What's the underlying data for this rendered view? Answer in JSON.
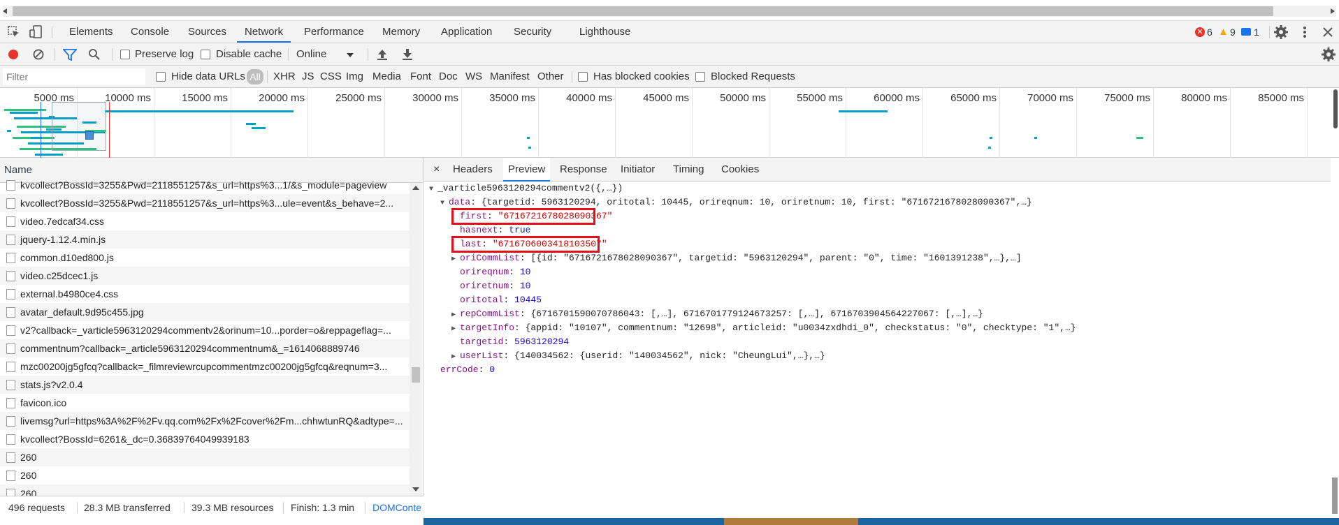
{
  "devtools": {
    "tabs": [
      "Elements",
      "Console",
      "Sources",
      "Network",
      "Performance",
      "Memory",
      "Application",
      "Security",
      "Lighthouse"
    ],
    "active_tab": "Network",
    "errors": "6",
    "warnings": "9",
    "info": "1"
  },
  "toolbar": {
    "preserve_log": "Preserve log",
    "disable_cache": "Disable cache",
    "throttling": "Online"
  },
  "filterbar": {
    "filter_placeholder": "Filter",
    "hide_data_urls": "Hide data URLs",
    "types": [
      "All",
      "XHR",
      "JS",
      "CSS",
      "Img",
      "Media",
      "Font",
      "Doc",
      "WS",
      "Manifest",
      "Other"
    ],
    "active_type": "All",
    "has_blocked_cookies": "Has blocked cookies",
    "blocked_requests": "Blocked Requests"
  },
  "timeline": {
    "ticks": [
      "5000 ms",
      "10000 ms",
      "15000 ms",
      "20000 ms",
      "25000 ms",
      "30000 ms",
      "35000 ms",
      "40000 ms",
      "45000 ms",
      "50000 ms",
      "55000 ms",
      "60000 ms",
      "65000 ms",
      "70000 ms",
      "75000 ms",
      "80000 ms",
      "85000 ms"
    ]
  },
  "requests": {
    "header": "Name",
    "items": [
      "kvcollect?BossId=3255&Pwd=2118551257&s_url=https%3...1/&s_module=pageview",
      "kvcollect?BossId=3255&Pwd=2118551257&s_url=https%3...ule=event&s_behave=2...",
      "video.7edcaf34.css",
      "jquery-1.12.4.min.js",
      "common.d10ed800.js",
      "video.c25dcec1.js",
      "external.b4980ce4.css",
      "avatar_default.9d95c455.jpg",
      "v2?callback=_varticle5963120294commentv2&orinum=10...porder=o&reppageflag=...",
      "commentnum?callback=_article5963120294commentnum&_=1614068889746",
      "mzc00200jg5gfcq?callback=_filmreviewrcupcommentmzc00200jg5gfcq&reqnum=3...",
      "stats.js?v2.0.4",
      "favicon.ico",
      "livemsg?url=https%3A%2F%2Fv.qq.com%2Fx%2Fcover%2Fm...chhwtunRQ&adtype=...",
      "kvcollect?BossId=6261&_dc=0.36839764049939183",
      "260",
      "260",
      "260"
    ]
  },
  "status": {
    "requests": "496 requests",
    "transferred": "28.3 MB transferred",
    "resources": "39.3 MB resources",
    "finish": "Finish: 1.3 min",
    "domcontent": "DOMConte"
  },
  "detail": {
    "tabs": [
      "Headers",
      "Preview",
      "Response",
      "Initiator",
      "Timing",
      "Cookies"
    ],
    "active_tab": "Preview",
    "close": "×",
    "root": "_varticle5963120294commentv2({,…})",
    "data_key": "data",
    "data_summary": "{targetid: 5963120294, oritotal: 10445, orireqnum: 10, oriretnum: 10, first: \"6716721678028090367\",…}",
    "first_key": "first",
    "first_val": "\"6716721678028090367\"",
    "hasnext_key": "hasnext",
    "hasnext_val": "true",
    "last_key": "last",
    "last_val": "\"6716706003418103507\"",
    "oricomm_key": "oriCommList",
    "oricomm_val": "[{id: \"6716721678028090367\", targetid: \"5963120294\", parent: \"0\", time: \"1601391238\",…},…]",
    "orireqnum_key": "orireqnum",
    "orireqnum_val": "10",
    "oriretnum_key": "oriretnum",
    "oriretnum_val": "10",
    "oritotal_key": "oritotal",
    "oritotal_val": "10445",
    "repcomm_key": "repCommList",
    "repcomm_val": "{6716701590070786043: [,…], 6716701779124673257: [,…], 6716703904564227067: [,…],…}",
    "targetinfo_key": "targetInfo",
    "targetinfo_val": "{appid: \"10107\", commentnum: \"12698\", articleid: \"u0034zxdhdi_0\", checkstatus: \"0\", checktype: \"1\",…}",
    "targetid_key": "targetid",
    "targetid_val": "5963120294",
    "userlist_key": "userList",
    "userlist_val": "{140034562: {userid: \"140034562\", nick: \"CheungLui\",…},…}",
    "errcode_key": "errCode",
    "errcode_val": "0"
  },
  "colors": {
    "accent": "#1a73e8",
    "highlight_box": "#e0101b",
    "record": "#e8332c"
  }
}
